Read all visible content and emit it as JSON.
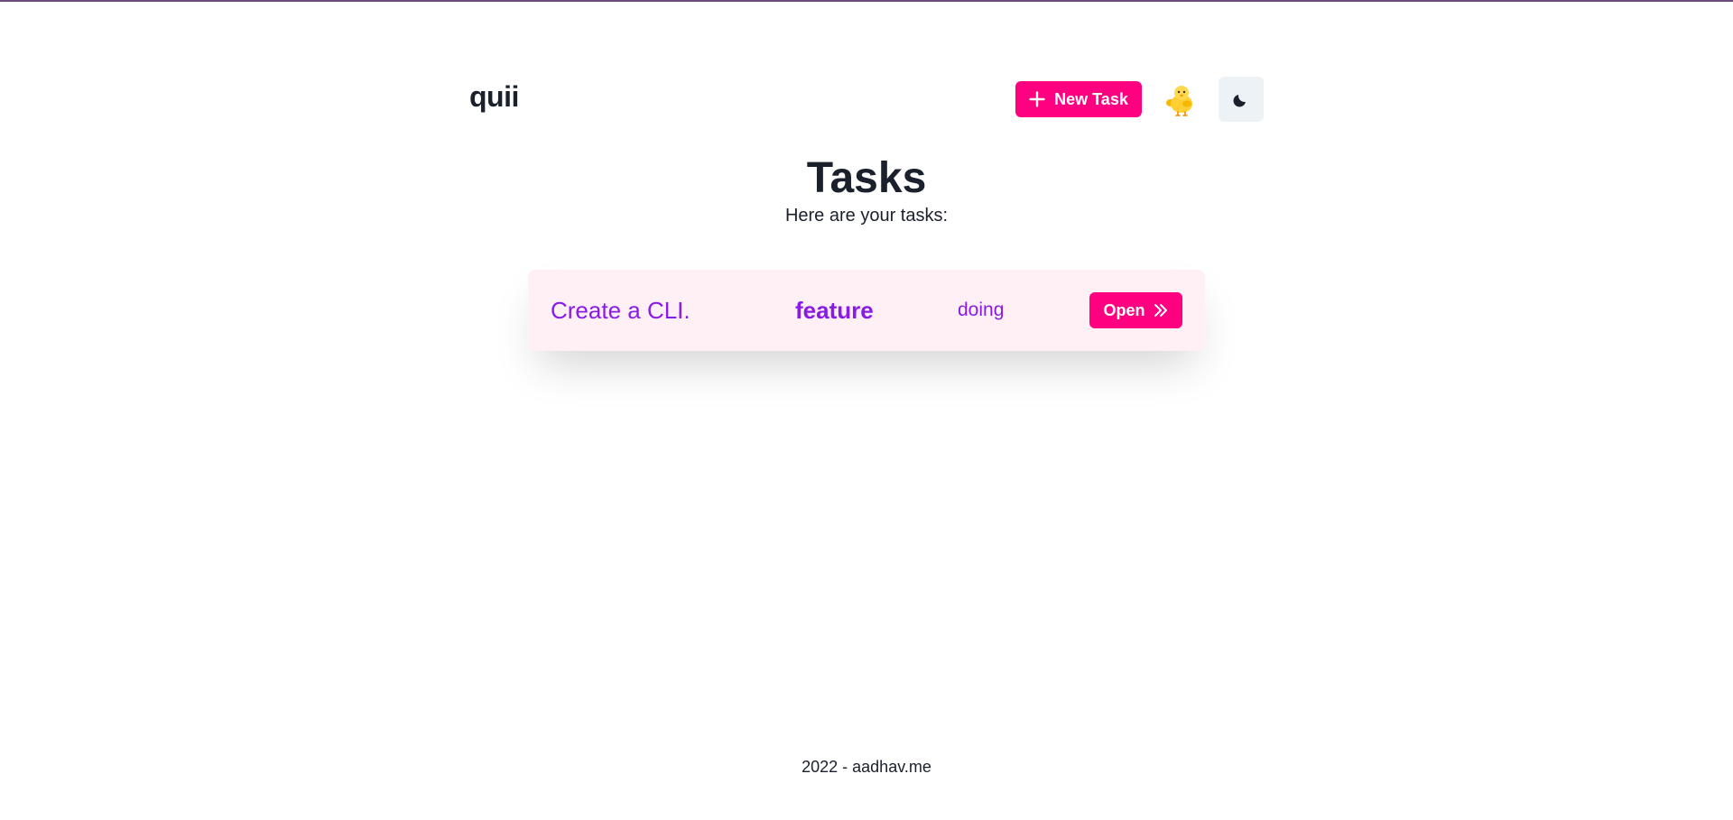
{
  "app": {
    "logo": "quii"
  },
  "header": {
    "new_task_label": "New Task",
    "avatar_emoji": "🐥",
    "theme_icon": "moon-icon"
  },
  "main": {
    "title": "Tasks",
    "subtitle": "Here are your tasks:"
  },
  "tasks": [
    {
      "title": "Create a CLI.",
      "tag": "feature",
      "status": "doing",
      "open_label": "Open"
    }
  ],
  "footer": {
    "text": "2022 - aadhav.me"
  },
  "colors": {
    "accent": "#ff0080",
    "task_text": "#8a1ae8",
    "card_bg": "#fff0f5",
    "theme_button_bg": "#edf2f7",
    "top_strip": "#6b4c7d"
  }
}
